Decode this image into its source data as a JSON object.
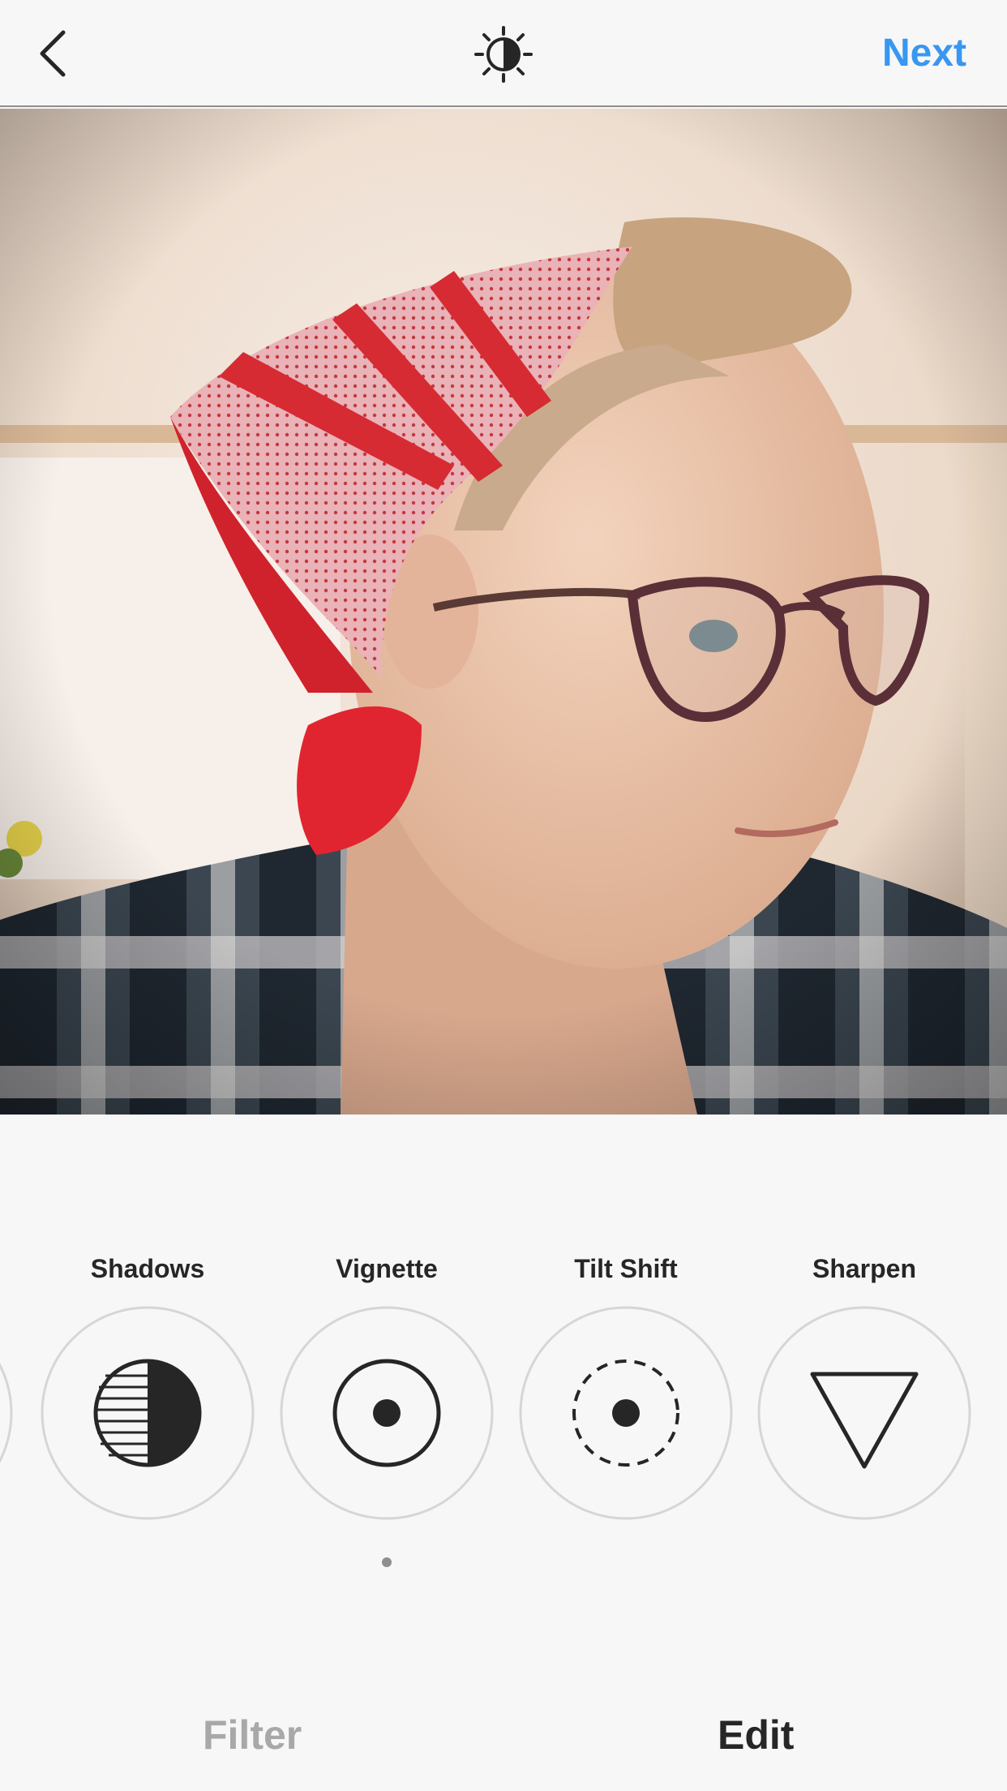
{
  "header": {
    "back_icon": "chevron-left-icon",
    "lux_icon": "lux-brightness-icon",
    "next_label": "Next",
    "next_color": "#3897f0"
  },
  "photo": {
    "subject": "photo-being-edited"
  },
  "tools": {
    "items": [
      {
        "label": "Shadows",
        "icon": "shadows-icon"
      },
      {
        "label": "Vignette",
        "icon": "vignette-icon"
      },
      {
        "label": "Tilt Shift",
        "icon": "tilt-shift-icon"
      },
      {
        "label": "Sharpen",
        "icon": "sharpen-icon"
      }
    ],
    "modified_indicator_on": "Vignette"
  },
  "tabs": {
    "filter_label": "Filter",
    "edit_label": "Edit",
    "active": "Edit"
  }
}
